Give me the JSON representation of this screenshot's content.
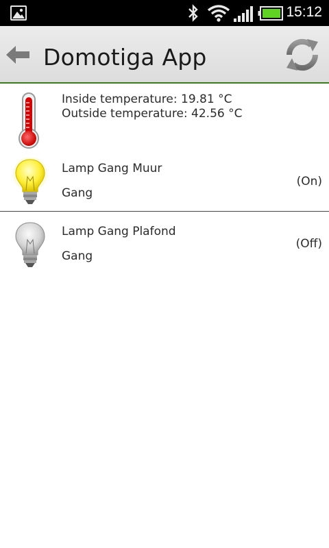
{
  "status_bar": {
    "time": "15:12",
    "icons": [
      "gallery-notification-icon",
      "bluetooth-icon",
      "wifi-icon",
      "signal-icon",
      "battery-icon"
    ]
  },
  "action_bar": {
    "title": "Domotiga App",
    "back_icon": "back-arrow-icon",
    "refresh_icon": "refresh-icon",
    "accent_color": "#3a7d1e"
  },
  "list": {
    "temperature": {
      "icon": "thermometer-icon",
      "inside": "Inside temperature: 19.81 °C",
      "outside": "Outside temperature: 42.56 °C"
    },
    "devices": [
      {
        "name": "Lamp Gang Muur",
        "location": "Gang",
        "state": "(On)",
        "icon": "lightbulb-on-icon"
      },
      {
        "name": "Lamp Gang Plafond",
        "location": "Gang",
        "state": "(Off)",
        "icon": "lightbulb-off-icon"
      }
    ]
  }
}
